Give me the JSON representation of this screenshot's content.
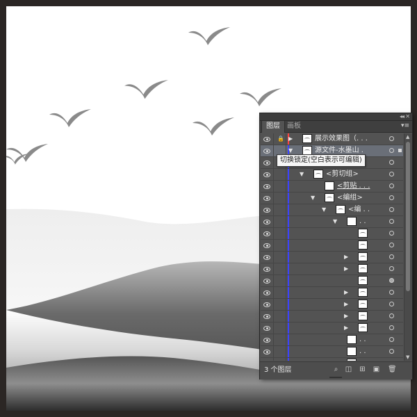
{
  "panel": {
    "tabs": [
      {
        "label": "图层",
        "active": true
      },
      {
        "label": "画板",
        "active": false
      }
    ],
    "tooltip": "切换锁定(空白表示可编辑)",
    "footer": {
      "layer_count": "3 个图层"
    },
    "colors": {
      "layer_bar_red": "#ff4040",
      "layer_bar_blue": "#3b42ff",
      "selected_row": "#6a6f78",
      "panel_bg": "#535353"
    },
    "rows": [
      {
        "name": "展示效果图（. . .",
        "indent": 0,
        "expander": "right",
        "thumb": "image",
        "locked": true,
        "color": "red",
        "selected": false,
        "target": "empty",
        "underline": false
      },
      {
        "name": "源文件-水墨山 .",
        "indent": 0,
        "expander": "down",
        "thumb": "image",
        "locked": false,
        "color": "blue",
        "selected": true,
        "target": "empty",
        "underline": false
      },
      {
        "name": "",
        "indent": 1,
        "expander": "",
        "thumb": "image",
        "locked": false,
        "color": "blue",
        "selected": false,
        "target": "empty",
        "underline": false
      },
      {
        "name": "<剪切组>",
        "indent": 1,
        "expander": "down",
        "thumb": "image",
        "locked": false,
        "color": "blue",
        "selected": false,
        "target": "empty",
        "underline": false
      },
      {
        "name": "<剪贴 . . .",
        "indent": 2,
        "expander": "",
        "thumb": "white",
        "locked": false,
        "color": "blue",
        "selected": false,
        "target": "empty",
        "underline": true
      },
      {
        "name": "<编组>",
        "indent": 2,
        "expander": "down",
        "thumb": "image",
        "locked": false,
        "color": "blue",
        "selected": false,
        "target": "empty",
        "underline": false
      },
      {
        "name": "<编 . .",
        "indent": 3,
        "expander": "down",
        "thumb": "image",
        "locked": false,
        "color": "blue",
        "selected": false,
        "target": "empty",
        "underline": false
      },
      {
        "name": ". .",
        "indent": 4,
        "expander": "down",
        "thumb": "white",
        "locked": false,
        "color": "blue",
        "selected": false,
        "target": "empty",
        "underline": false
      },
      {
        "name": "",
        "indent": 5,
        "expander": "",
        "thumb": "image",
        "locked": false,
        "color": "blue",
        "selected": false,
        "target": "empty",
        "underline": false
      },
      {
        "name": "",
        "indent": 5,
        "expander": "",
        "thumb": "image",
        "locked": false,
        "color": "blue",
        "selected": false,
        "target": "empty",
        "underline": false
      },
      {
        "name": "",
        "indent": 5,
        "expander": "right",
        "thumb": "image",
        "locked": false,
        "color": "blue",
        "selected": false,
        "target": "empty",
        "underline": false
      },
      {
        "name": "",
        "indent": 5,
        "expander": "right",
        "thumb": "image",
        "locked": false,
        "color": "blue",
        "selected": false,
        "target": "empty",
        "underline": false
      },
      {
        "name": "",
        "indent": 5,
        "expander": "",
        "thumb": "image",
        "locked": false,
        "color": "blue",
        "selected": false,
        "target": "filled",
        "underline": false
      },
      {
        "name": "",
        "indent": 5,
        "expander": "right",
        "thumb": "image",
        "locked": false,
        "color": "blue",
        "selected": false,
        "target": "empty",
        "underline": false
      },
      {
        "name": "",
        "indent": 5,
        "expander": "right",
        "thumb": "image",
        "locked": false,
        "color": "blue",
        "selected": false,
        "target": "empty",
        "underline": false
      },
      {
        "name": "",
        "indent": 5,
        "expander": "right",
        "thumb": "image",
        "locked": false,
        "color": "blue",
        "selected": false,
        "target": "empty",
        "underline": false
      },
      {
        "name": "",
        "indent": 5,
        "expander": "right",
        "thumb": "image",
        "locked": false,
        "color": "blue",
        "selected": false,
        "target": "empty",
        "underline": false
      },
      {
        "name": ". .",
        "indent": 4,
        "expander": "",
        "thumb": "white",
        "locked": false,
        "color": "blue",
        "selected": false,
        "target": "empty",
        "underline": false
      },
      {
        "name": ". .",
        "indent": 4,
        "expander": "",
        "thumb": "white",
        "locked": false,
        "color": "blue",
        "selected": false,
        "target": "empty",
        "underline": false
      },
      {
        "name": ". .",
        "indent": 4,
        "expander": "",
        "thumb": "white",
        "locked": false,
        "color": "blue",
        "selected": false,
        "target": "empty",
        "underline": false
      }
    ]
  },
  "artwork": {
    "background": "#ffffff",
    "frame_color": "#2b2624",
    "bird_color": "#8a8a8a",
    "birds": 7,
    "mountain_layers": 4
  }
}
